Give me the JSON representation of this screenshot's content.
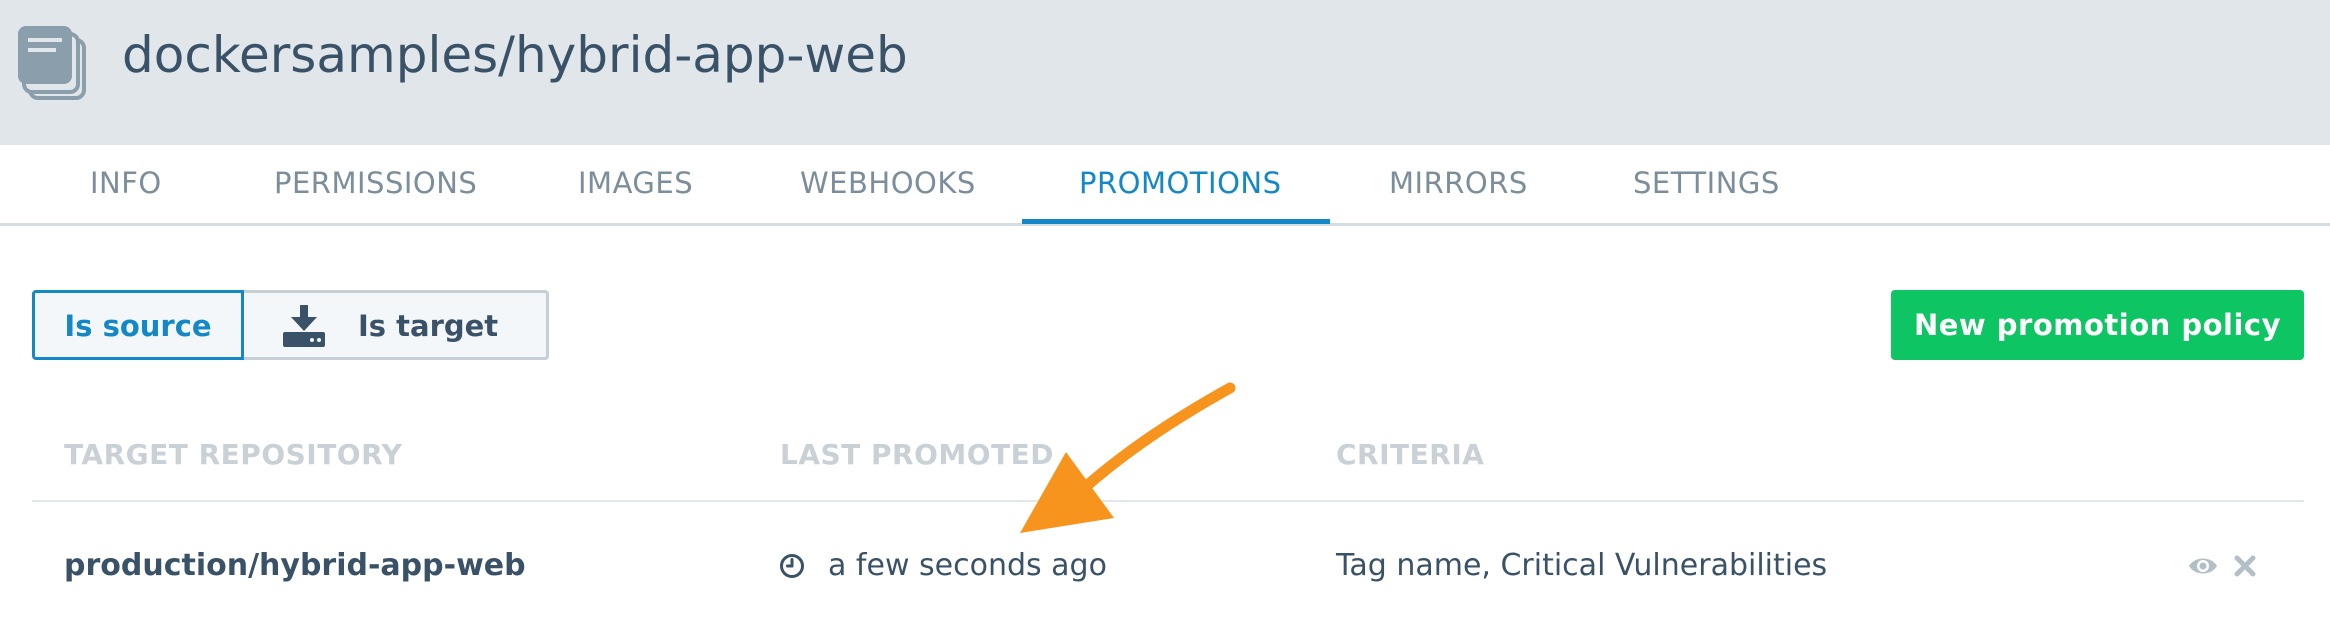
{
  "header": {
    "repo_icon": "stacked-pages-icon",
    "title": "dockersamples/hybrid-app-web"
  },
  "tabs": [
    {
      "label": "INFO",
      "active": false
    },
    {
      "label": "PERMISSIONS",
      "active": false
    },
    {
      "label": "IMAGES",
      "active": false
    },
    {
      "label": "WEBHOOKS",
      "active": false
    },
    {
      "label": "PROMOTIONS",
      "active": true
    },
    {
      "label": "MIRRORS",
      "active": false
    },
    {
      "label": "SETTINGS",
      "active": false
    }
  ],
  "filter": {
    "source_label": "Is source",
    "target_label": "Is target",
    "target_icon": "download-to-drive-icon",
    "selected": "Is source"
  },
  "actions": {
    "new_policy_label": "New promotion policy"
  },
  "table": {
    "columns": [
      "TARGET REPOSITORY",
      "LAST PROMOTED",
      "CRITERIA"
    ],
    "rows": [
      {
        "target_repository": "production/hybrid-app-web",
        "last_promoted": "a few seconds ago",
        "criteria": "Tag name, Critical Vulnerabilities",
        "actions": [
          "eye-icon",
          "close-icon"
        ]
      }
    ]
  },
  "annotation": {
    "type": "arrow",
    "color": "#f7941d",
    "points_to": "last_promoted"
  },
  "colors": {
    "header_bg": "#e0e6e9",
    "accent": "#1488c6",
    "primary_button": "#0dc562",
    "text": "#3a5267",
    "muted": "#7c8d9b"
  }
}
